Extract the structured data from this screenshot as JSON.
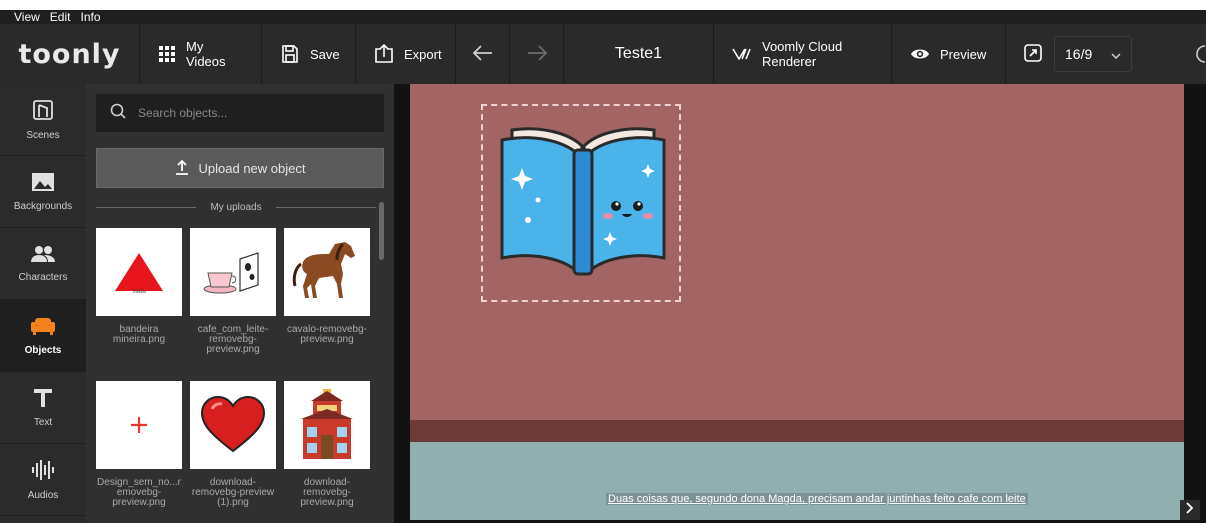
{
  "menu": {
    "items": [
      "View",
      "Edit",
      "Info"
    ]
  },
  "toolbar": {
    "logo": "toonly",
    "my_videos": "My Videos",
    "save": "Save",
    "export": "Export",
    "project_title": "Teste1",
    "renderer": "Voomly Cloud Renderer",
    "preview": "Preview",
    "aspect_ratio": "16/9"
  },
  "sidebar": {
    "items": [
      {
        "label": "Scenes",
        "icon": "scenes-icon"
      },
      {
        "label": "Backgrounds",
        "icon": "backgrounds-icon"
      },
      {
        "label": "Characters",
        "icon": "characters-icon"
      },
      {
        "label": "Objects",
        "icon": "sofa-icon",
        "active": true
      },
      {
        "label": "Text",
        "icon": "text-icon"
      },
      {
        "label": "Audios",
        "icon": "audio-icon"
      }
    ]
  },
  "panel": {
    "search_placeholder": "Search objects...",
    "upload_label": "Upload new object",
    "section_label": "My uploads",
    "uploads": [
      {
        "caption": "bandeira mineira.png",
        "icon": "flag-triangle-icon"
      },
      {
        "caption": "cafe_com_leite-removebg-preview.png",
        "icon": "coffee-milk-icon"
      },
      {
        "caption": "cavalo-removebg-preview.png",
        "icon": "horse-icon"
      },
      {
        "caption": "Design_sem_no...removebg-preview.png",
        "icon": "plus-icon"
      },
      {
        "caption": "download-removebg-preview (1).png",
        "icon": "heart-icon"
      },
      {
        "caption": "download-removebg-preview.png",
        "icon": "school-icon"
      }
    ]
  },
  "canvas": {
    "subtitle": "Duas coisas que, segundo dona Magda, precisam andar juntinhas feito cafe com leite"
  },
  "colors": {
    "toolbar_bg": "#2a2a2a",
    "panel_bg": "#303030",
    "accent_orange": "#f5821f",
    "canvas_wall": "#a26564",
    "canvas_floor": "#6c3a38",
    "canvas_water": "#90b0b0"
  }
}
